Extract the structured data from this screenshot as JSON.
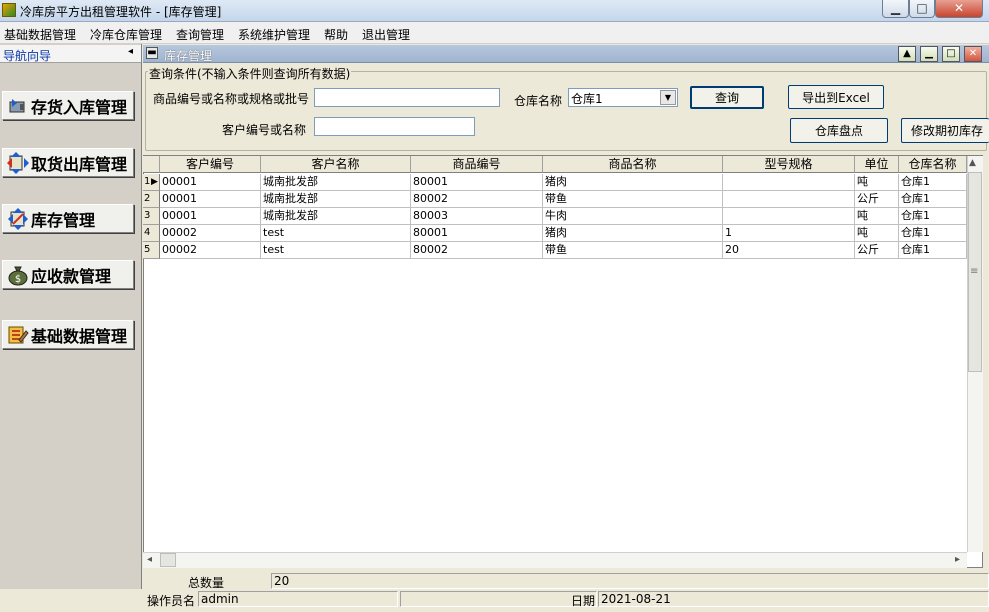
{
  "window": {
    "title": "冷库房平方出租管理软件 - [库存管理]",
    "min_label": "▁",
    "max_label": "□",
    "close_label": "✕"
  },
  "menu": [
    "基础数据管理",
    "冷库仓库管理",
    "查询管理",
    "系统维护管理",
    "帮助",
    "退出管理"
  ],
  "nav": {
    "title": "导航向导",
    "collapse": "◂",
    "items": [
      {
        "label": "存货入库管理",
        "icon": "stock-in-icon"
      },
      {
        "label": "取货出库管理",
        "icon": "stock-out-icon"
      },
      {
        "label": "库存管理",
        "icon": "inventory-icon"
      },
      {
        "label": "应收款管理",
        "icon": "money-bag-icon"
      },
      {
        "label": "基础数据管理",
        "icon": "basic-data-icon"
      }
    ]
  },
  "child_window": {
    "title": "库存管理",
    "sys_label": "▬",
    "up_label": "▲",
    "min_label": "▁",
    "max_label": "□",
    "close_label": "✕"
  },
  "query": {
    "legend": "查询条件(不输入条件则查询所有数据)",
    "product_label": "商品编号或名称或规格或批号",
    "product_value": "",
    "warehouse_label": "仓库名称",
    "warehouse_value": "仓库1",
    "customer_label": "客户编号或名称",
    "customer_value": "",
    "query_button": "查询",
    "export_button": "导出到Excel",
    "stocktake_button": "仓库盘点",
    "modify_button": "修改期初库存"
  },
  "grid": {
    "columns": [
      "客户编号",
      "客户名称",
      "商品编号",
      "商品名称",
      "型号规格",
      "单位",
      "仓库名称"
    ],
    "rows": [
      {
        "no": "1",
        "current": true,
        "cells": [
          "00001",
          "城南批发部",
          "80001",
          "猪肉",
          "",
          "吨",
          "仓库1"
        ]
      },
      {
        "no": "2",
        "current": false,
        "cells": [
          "00001",
          "城南批发部",
          "80002",
          "带鱼",
          "",
          "公斤",
          "仓库1"
        ]
      },
      {
        "no": "3",
        "current": false,
        "cells": [
          "00001",
          "城南批发部",
          "80003",
          "牛肉",
          "",
          "吨",
          "仓库1"
        ]
      },
      {
        "no": "4",
        "current": false,
        "cells": [
          "00002",
          "test",
          "80001",
          "猪肉",
          "1",
          "吨",
          "仓库1"
        ]
      },
      {
        "no": "5",
        "current": false,
        "cells": [
          "00002",
          "test",
          "80002",
          "带鱼",
          "20",
          "公斤",
          "仓库1"
        ]
      }
    ],
    "scroll_up": "▲",
    "scroll_mark": "≡",
    "scroll_left": "◂",
    "scroll_right": "▸"
  },
  "footer": {
    "total_label": "总数量",
    "total_value": "20",
    "operator_label": "操作员名",
    "operator_value": "admin",
    "date_label": "日期",
    "date_value": "2021-08-21"
  }
}
